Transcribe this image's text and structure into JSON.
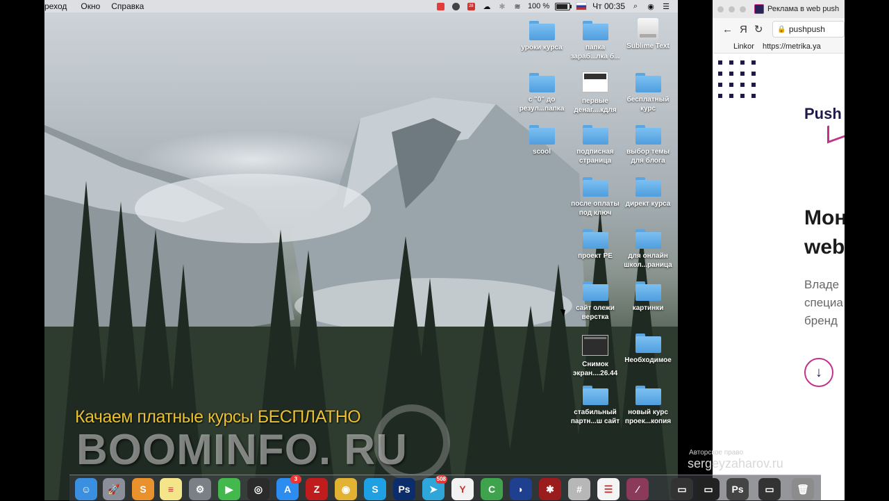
{
  "menubar": {
    "items": [
      "реход",
      "Окно",
      "Справка"
    ],
    "battery": "100 %",
    "clock": "Чт 00:35",
    "tray_badge": "28"
  },
  "desktop": {
    "icons": [
      {
        "label": "уроки курса",
        "type": "folder"
      },
      {
        "label": "папка зараб...лка б...",
        "type": "folder"
      },
      {
        "label": "Sublime Text",
        "type": "drive"
      },
      {
        "label": "с \"0\" до резул...папка",
        "type": "folder"
      },
      {
        "label": "первые денаг....кдля",
        "type": "thumb"
      },
      {
        "label": "бесплатный курс",
        "type": "folder"
      },
      {
        "label": "scool",
        "type": "folder"
      },
      {
        "label": "подписная страница",
        "type": "folder"
      },
      {
        "label": "выбор темы для блога",
        "type": "folder"
      },
      {
        "label": "после оплаты под ключ",
        "type": "folder"
      },
      {
        "label": "директ курса",
        "type": "folder"
      },
      {
        "label": "проект PE",
        "type": "folder"
      },
      {
        "label": "для онлайн школ...раница",
        "type": "folder"
      },
      {
        "label": "сайт олежи верстка",
        "type": "folder"
      },
      {
        "label": "картинки",
        "type": "folder"
      },
      {
        "label": "Снимок экран....26.44",
        "type": "thumb-dark"
      },
      {
        "label": "Необходимое",
        "type": "folder"
      },
      {
        "label": "стабильный партн...ш сайт",
        "type": "folder"
      },
      {
        "label": "новый курс проек...копия",
        "type": "folder"
      }
    ]
  },
  "watermark": {
    "tagline": "Качаем платные курсы БЕСПЛАТНО",
    "brand": "BOOMINFO. RU"
  },
  "dock": {
    "apps": [
      {
        "name": "finder",
        "glyph": "☺",
        "color": "#3b8fe0"
      },
      {
        "name": "launchpad",
        "glyph": "🚀",
        "color": "#8a8f99"
      },
      {
        "name": "sublime",
        "glyph": "S",
        "color": "#e8912d"
      },
      {
        "name": "notes",
        "glyph": "≡",
        "color": "#f4e48a"
      },
      {
        "name": "system-preferences",
        "glyph": "⚙",
        "color": "#7b7f86"
      },
      {
        "name": "facetime",
        "glyph": "▶",
        "color": "#43b84d"
      },
      {
        "name": "obs",
        "glyph": "◎",
        "color": "#2b2b2b"
      },
      {
        "name": "app-store",
        "glyph": "A",
        "color": "#2d8cf0",
        "badge": "3"
      },
      {
        "name": "filezilla",
        "glyph": "Z",
        "color": "#bf1d1d"
      },
      {
        "name": "chrome",
        "glyph": "◉",
        "color": "#e2b233"
      },
      {
        "name": "skype",
        "glyph": "S",
        "color": "#1fa0e3"
      },
      {
        "name": "photoshop",
        "glyph": "Ps",
        "color": "#0c2d6b"
      },
      {
        "name": "telegram",
        "glyph": "➤",
        "color": "#2ea6da",
        "badge": "508"
      },
      {
        "name": "yandex-browser",
        "glyph": "Y",
        "color": "#f2f2f2"
      },
      {
        "name": "camtasia",
        "glyph": "C",
        "color": "#3fa34d"
      },
      {
        "name": "vpn",
        "glyph": "◗",
        "color": "#1f3f8f"
      },
      {
        "name": "bug-tool",
        "glyph": "✱",
        "color": "#9b1c1c"
      },
      {
        "name": "calculator",
        "glyph": "#",
        "color": "#b7b7b7"
      },
      {
        "name": "reminders",
        "glyph": "☰",
        "color": "#f4f4f4"
      },
      {
        "name": "broom",
        "glyph": "⁄",
        "color": "#8b3a5a"
      },
      {
        "name": "window-1",
        "glyph": "▭",
        "color": "#333"
      },
      {
        "name": "window-2",
        "glyph": "▭",
        "color": "#222"
      },
      {
        "name": "window-3",
        "glyph": "Ps",
        "color": "#444"
      },
      {
        "name": "window-4",
        "glyph": "▭",
        "color": "#333"
      },
      {
        "name": "trash",
        "glyph": "🗑",
        "color": "#8c8c8c"
      }
    ]
  },
  "browser": {
    "tab_title": "Реклама в web push",
    "url": "pushpush",
    "bookmarks": [
      "Linkor",
      "https://metrika.ya"
    ],
    "brand": "Push",
    "headline_line1": "Мон",
    "headline_line2": "web",
    "subtext": [
      "Владе",
      "специа",
      "бренд"
    ],
    "nav_back": "←",
    "nav_yandex": "Я",
    "nav_reload": "↻",
    "scroll_arrow": "↓"
  },
  "overlay": {
    "copyright_label": "Авторское право",
    "copyright_name": "sergeyzaharov.ru"
  }
}
